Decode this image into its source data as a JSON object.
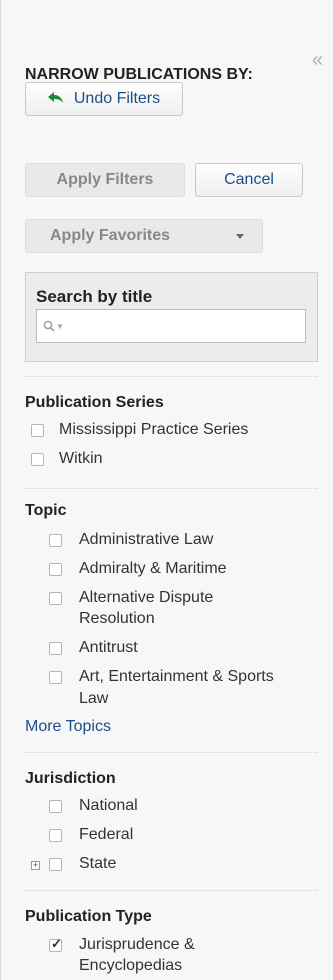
{
  "panel": {
    "collapse_icon": "«",
    "heading": "NARROW PUBLICATIONS BY:",
    "undo_label": "Undo Filters",
    "apply_label": "Apply Filters",
    "cancel_label": "Cancel",
    "favorites_label": "Apply Favorites"
  },
  "search": {
    "title": "Search by title",
    "placeholder": ""
  },
  "sections": {
    "series": {
      "title": "Publication Series",
      "items": [
        {
          "label": "Mississippi Practice Series",
          "checked": false
        },
        {
          "label": "Witkin",
          "checked": false
        }
      ]
    },
    "topic": {
      "title": "Topic",
      "items": [
        {
          "label": "Administrative Law",
          "checked": false
        },
        {
          "label": "Admiralty & Maritime",
          "checked": false
        },
        {
          "label_1": "Alternative Dispute",
          "label_2": "Resolution",
          "checked": false
        },
        {
          "label": "Antitrust",
          "checked": false
        },
        {
          "label_1": "Art, Entertainment & Sports",
          "label_2": "Law",
          "checked": false
        }
      ],
      "more": "More Topics"
    },
    "jurisdiction": {
      "title": "Jurisdiction",
      "items": [
        {
          "label": "National",
          "checked": false
        },
        {
          "label": "Federal",
          "checked": false
        },
        {
          "label": "State",
          "checked": false
        }
      ],
      "expand_icon": "⊞"
    },
    "pubtype": {
      "title": "Publication Type",
      "items": [
        {
          "label_1": "Jurisprudence &",
          "label_2": "Encyclopedias",
          "checked": true
        }
      ]
    }
  },
  "colors": {
    "accent_link": "#1a4f8a",
    "undo_arrow": "#1c8a3c",
    "panel_bg": "#f7f7f7"
  }
}
